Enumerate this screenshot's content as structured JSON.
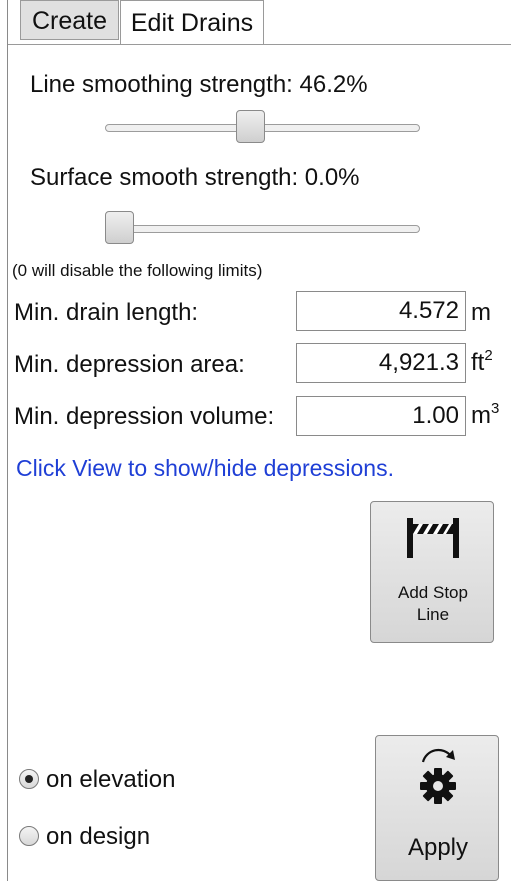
{
  "tabs": {
    "create": "Create",
    "edit_drains": "Edit Drains"
  },
  "line_smoothing": {
    "label": "Line smoothing strength: 46.2%",
    "value_fraction": 0.462
  },
  "surface_smoothing": {
    "label": "Surface smooth strength: 0.0%",
    "value_fraction": 0.0
  },
  "limits_note": "(0 will disable the following limits)",
  "fields": {
    "drain_length": {
      "label": "Min. drain length:",
      "value": "4.572",
      "unit": "m"
    },
    "depression_area": {
      "label": "Min. depression area:",
      "value": "4,921.3",
      "unit": "ft",
      "unit_sup": "2"
    },
    "depression_volume": {
      "label": "Min. depression volume:",
      "value": "1.00",
      "unit": "m",
      "unit_sup": "3"
    }
  },
  "view_hint": "Click View to show/hide depressions.",
  "add_stop_line": {
    "line1": "Add Stop",
    "line2": "Line",
    "icon": "barrier-icon"
  },
  "radios": {
    "on_elevation": "on elevation",
    "on_design": "on design",
    "selected": "on_elevation"
  },
  "apply": {
    "label": "Apply",
    "icon": "gear-icon"
  },
  "colors": {
    "link": "#1f3fd6"
  }
}
